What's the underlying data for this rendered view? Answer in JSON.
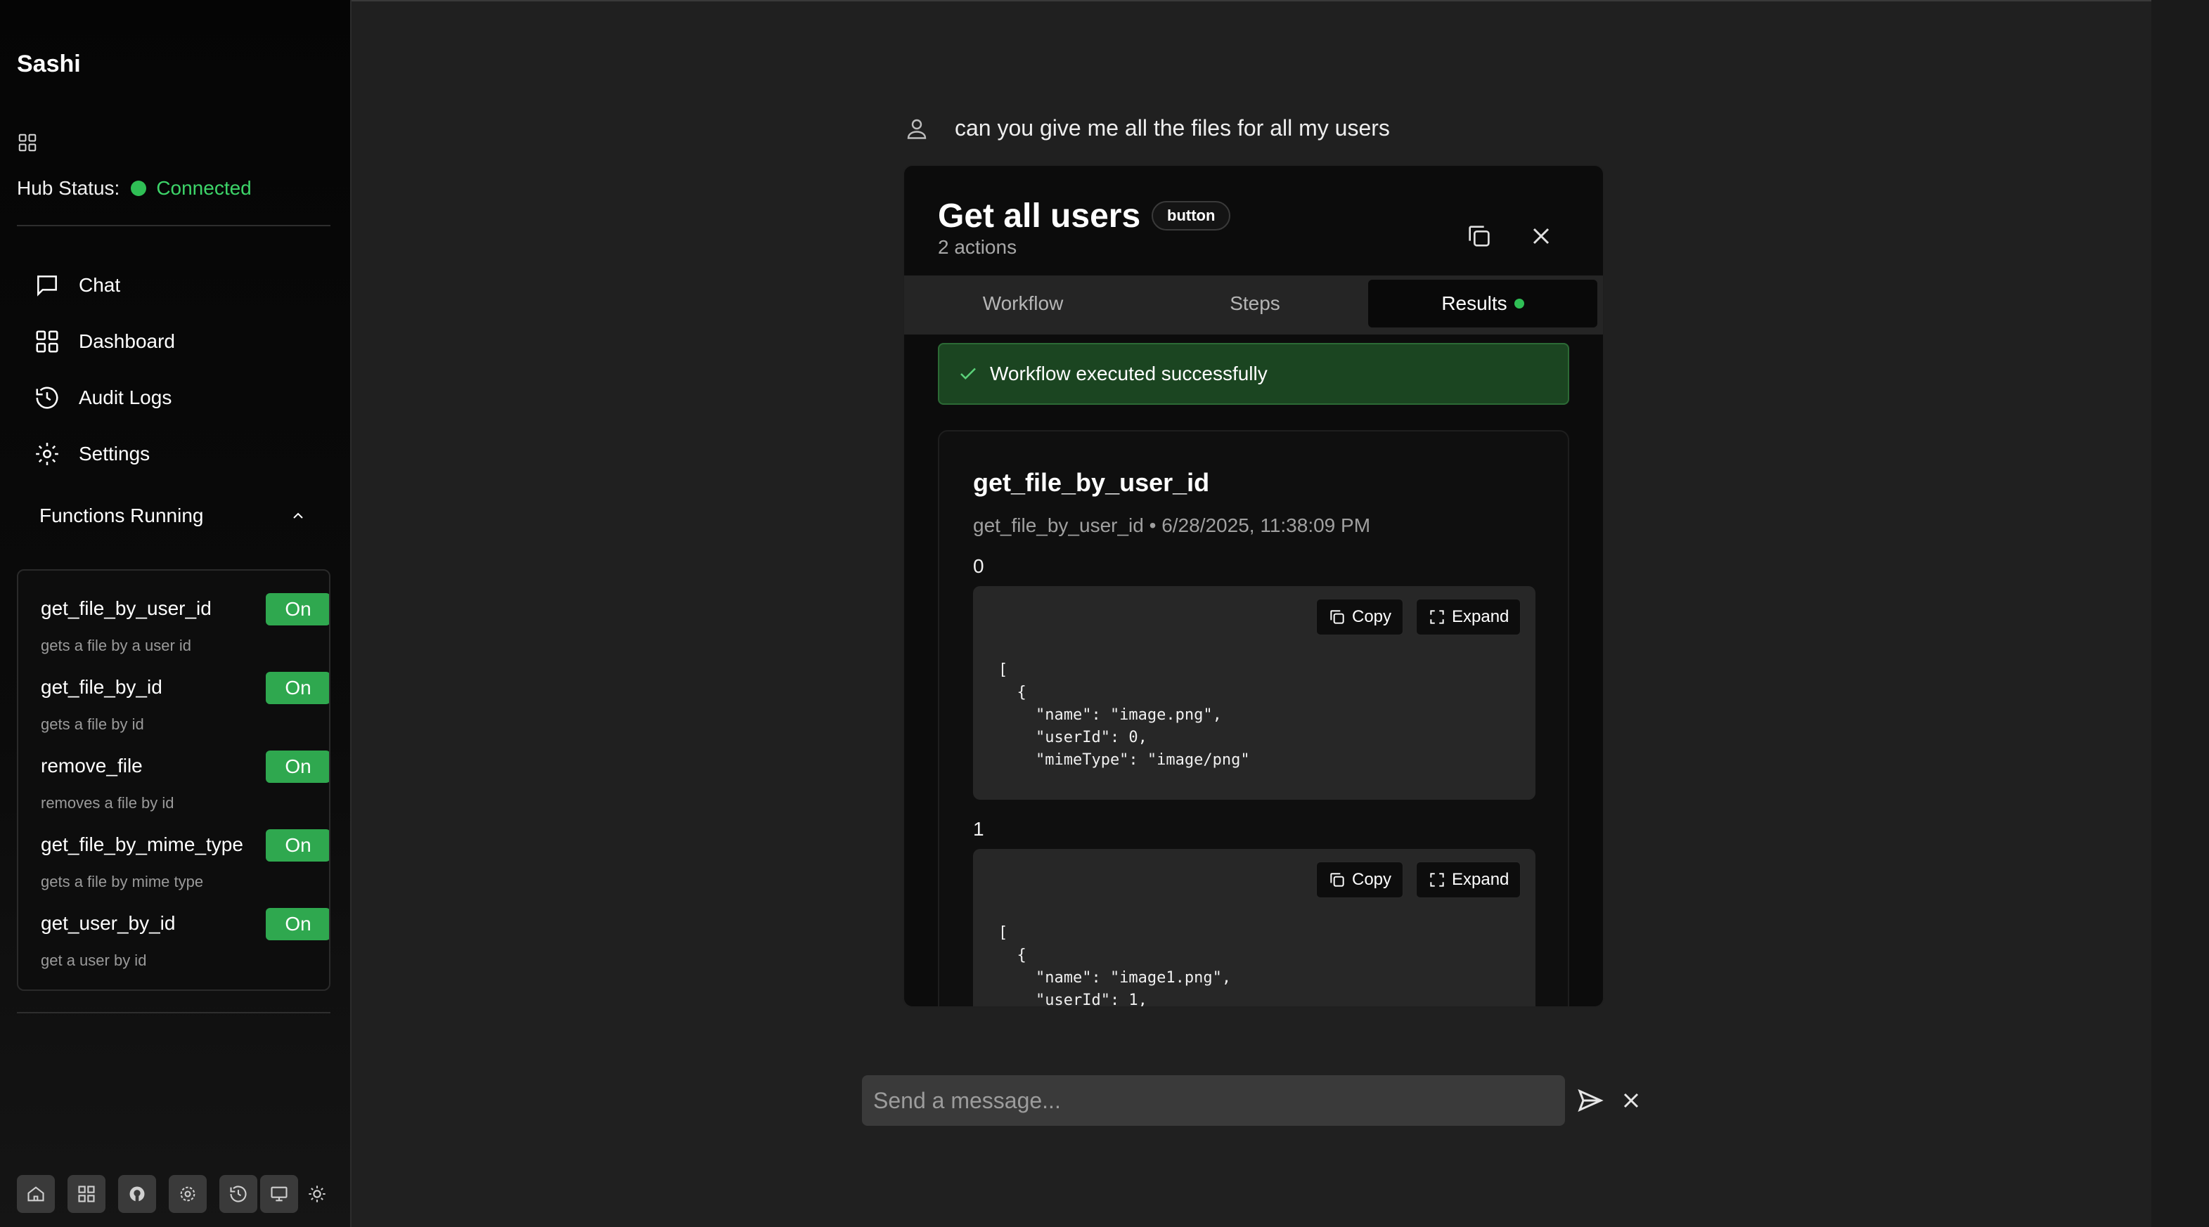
{
  "sidebar": {
    "brand": "Sashi",
    "hub_status_label": "Hub Status:",
    "hub_status_value": "Connected",
    "nav": [
      {
        "label": "Chat",
        "icon": "chat-icon"
      },
      {
        "label": "Dashboard",
        "icon": "dashboard-icon"
      },
      {
        "label": "Audit Logs",
        "icon": "history-icon"
      },
      {
        "label": "Settings",
        "icon": "gear-icon"
      }
    ],
    "functions_running_label": "Functions Running",
    "functions": [
      {
        "name": "get_file_by_user_id",
        "desc": "gets a file by a user id",
        "toggle": "On"
      },
      {
        "name": "get_file_by_id",
        "desc": "gets a file by id",
        "toggle": "On"
      },
      {
        "name": "remove_file",
        "desc": "removes a file by id",
        "toggle": "On"
      },
      {
        "name": "get_file_by_mime_type",
        "desc": "gets a file by mime type",
        "toggle": "On"
      },
      {
        "name": "get_user_by_id",
        "desc": "get a user by id",
        "toggle": "On"
      }
    ],
    "bottom_icons": [
      "home-icon",
      "grid-icon",
      "github-icon",
      "gear-icon",
      "history-icon",
      "monitor-icon",
      "sun-icon",
      "loader-icon"
    ]
  },
  "chat": {
    "user_message": "can you give me all the files for all my users",
    "card": {
      "title": "Get all users",
      "badge": "button",
      "subtitle": "2 actions",
      "tabs": [
        "Workflow",
        "Steps",
        "Results"
      ],
      "active_tab": "Results",
      "success_message": "Workflow executed successfully",
      "result": {
        "title": "get_file_by_user_id",
        "meta": "get_file_by_user_id • 6/28/2025, 11:38:09 PM",
        "copy_label": "Copy",
        "expand_label": "Expand",
        "items": [
          {
            "index": "0",
            "code": "[\n  {\n    \"name\": \"image.png\",\n    \"userId\": 0,\n    \"mimeType\": \"image/png\""
          },
          {
            "index": "1",
            "code": "[\n  {\n    \"name\": \"image1.png\",\n    \"userId\": 1,"
          }
        ]
      }
    },
    "input_placeholder": "Send a message..."
  },
  "colors": {
    "accent_green": "#2fbf55",
    "toggle_green": "#2fa84f",
    "success_bg": "#1b4521"
  }
}
